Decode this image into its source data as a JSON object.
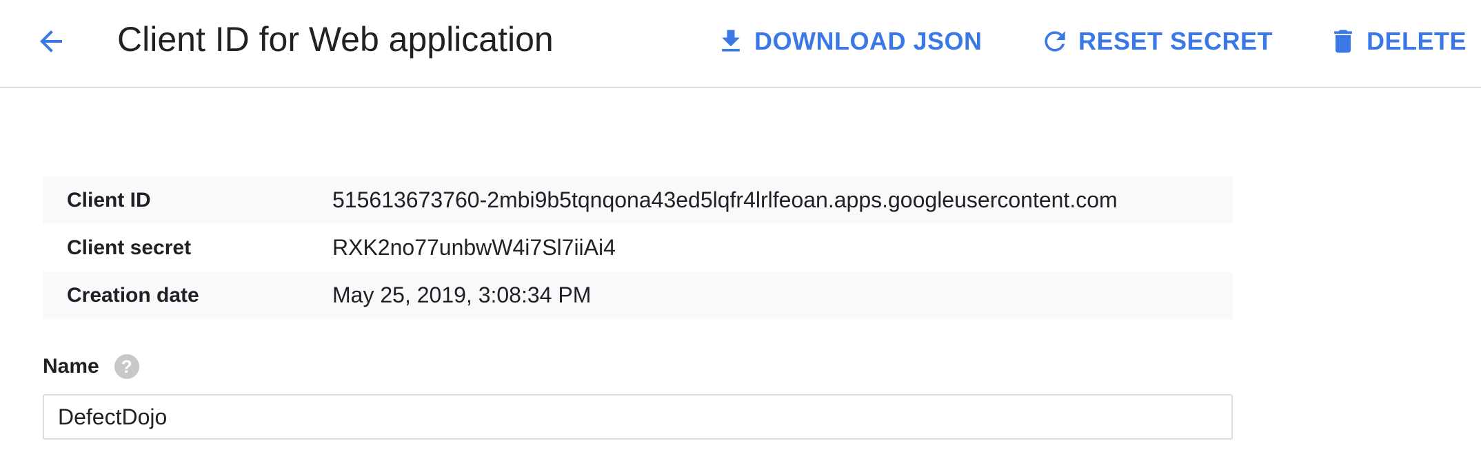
{
  "header": {
    "title": "Client ID for Web application",
    "back_icon": "arrow-left-icon",
    "accent_color": "#3b78e7",
    "actions": {
      "download_json": {
        "label": "DOWNLOAD JSON",
        "icon": "download-icon"
      },
      "reset_secret": {
        "label": "RESET SECRET",
        "icon": "refresh-icon"
      },
      "delete": {
        "label": "DELETE",
        "icon": "trash-icon"
      }
    }
  },
  "details": {
    "client_id": {
      "label": "Client ID",
      "value": "515613673760-2mbi9b5tqnqona43ed5lqfr4lrlfeoan.apps.googleusercontent.com"
    },
    "client_secret": {
      "label": "Client secret",
      "value": "RXK2no77unbwW4i7Sl7iiAi4"
    },
    "creation_date": {
      "label": "Creation date",
      "value": "May 25, 2019, 3:08:34 PM"
    }
  },
  "form": {
    "name_label": "Name",
    "help_icon": "help-circle-icon",
    "name_value": "DefectDojo"
  }
}
